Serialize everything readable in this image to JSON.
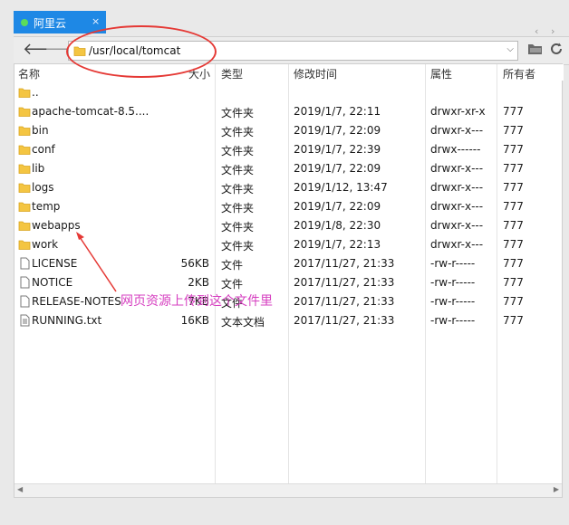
{
  "tab": {
    "title": "阿里云",
    "close": "×"
  },
  "tabbar": {
    "nav_left": "‹",
    "nav_right": "›"
  },
  "nav": {
    "back": "🡐",
    "forward": "🡒",
    "path": "/usr/local/tomcat",
    "dropdown": "⌵"
  },
  "columns": {
    "name": "名称",
    "size": "大小",
    "type": "类型",
    "modified": "修改时间",
    "attrs": "属性",
    "owner": "所有者"
  },
  "rows": [
    {
      "icon": "folder-icon",
      "name": "..",
      "size": "",
      "type": "",
      "modified": "",
      "attrs": "",
      "owner": ""
    },
    {
      "icon": "folder-icon",
      "name": "apache-tomcat-8.5....",
      "size": "",
      "type": "文件夹",
      "modified": "2019/1/7, 22:11",
      "attrs": "drwxr-xr-x",
      "owner": "777"
    },
    {
      "icon": "folder-icon",
      "name": "bin",
      "size": "",
      "type": "文件夹",
      "modified": "2019/1/7, 22:09",
      "attrs": "drwxr-x---",
      "owner": "777"
    },
    {
      "icon": "folder-icon",
      "name": "conf",
      "size": "",
      "type": "文件夹",
      "modified": "2019/1/7, 22:39",
      "attrs": "drwx------",
      "owner": "777"
    },
    {
      "icon": "folder-icon",
      "name": "lib",
      "size": "",
      "type": "文件夹",
      "modified": "2019/1/7, 22:09",
      "attrs": "drwxr-x---",
      "owner": "777"
    },
    {
      "icon": "folder-icon",
      "name": "logs",
      "size": "",
      "type": "文件夹",
      "modified": "2019/1/12, 13:47",
      "attrs": "drwxr-x---",
      "owner": "777"
    },
    {
      "icon": "folder-icon",
      "name": "temp",
      "size": "",
      "type": "文件夹",
      "modified": "2019/1/7, 22:09",
      "attrs": "drwxr-x---",
      "owner": "777"
    },
    {
      "icon": "folder-icon",
      "name": "webapps",
      "size": "",
      "type": "文件夹",
      "modified": "2019/1/8, 22:30",
      "attrs": "drwxr-x---",
      "owner": "777"
    },
    {
      "icon": "folder-icon",
      "name": "work",
      "size": "",
      "type": "文件夹",
      "modified": "2019/1/7, 22:13",
      "attrs": "drwxr-x---",
      "owner": "777"
    },
    {
      "icon": "file-icon",
      "name": "LICENSE",
      "size": "56KB",
      "type": "文件",
      "modified": "2017/11/27, 21:33",
      "attrs": "-rw-r-----",
      "owner": "777"
    },
    {
      "icon": "file-icon",
      "name": "NOTICE",
      "size": "2KB",
      "type": "文件",
      "modified": "2017/11/27, 21:33",
      "attrs": "-rw-r-----",
      "owner": "777"
    },
    {
      "icon": "file-icon",
      "name": "RELEASE-NOTES",
      "size": "7KB",
      "type": "文件",
      "modified": "2017/11/27, 21:33",
      "attrs": "-rw-r-----",
      "owner": "777"
    },
    {
      "icon": "text-file-icon",
      "name": "RUNNING.txt",
      "size": "16KB",
      "type": "文本文档",
      "modified": "2017/11/27, 21:33",
      "attrs": "-rw-r-----",
      "owner": "777"
    }
  ],
  "annotation": {
    "text": "网页资源上传到这个文件里"
  },
  "colors": {
    "tab_blue": "#1e88e5",
    "annotation_red": "#e53935",
    "annotation_magenta": "#d63fc0",
    "folder_yellow": "#f4c542"
  }
}
